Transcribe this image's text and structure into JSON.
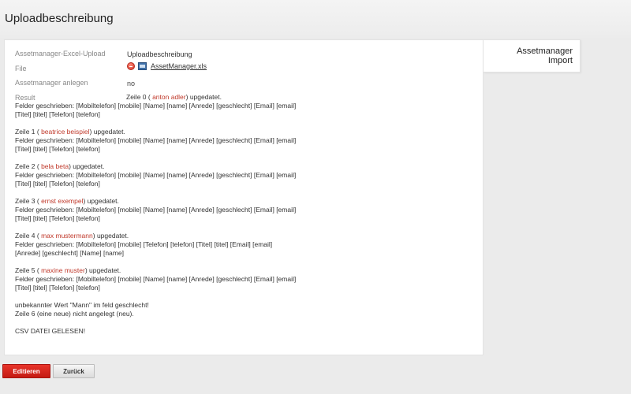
{
  "page": {
    "title": "Uploadbeschreibung"
  },
  "side_box": {
    "line1": "Assetmanager",
    "line2": "Import"
  },
  "fields": [
    {
      "label": "Assetmanager-Excel-Upload",
      "value": "Uploadbeschreibung"
    },
    {
      "label": "File",
      "value": "AssetManager.xls"
    },
    {
      "label": "Assetmanager anlegen",
      "value": "no"
    },
    {
      "label": "Result",
      "value": ""
    }
  ],
  "file_icons": [
    "delete-icon",
    "excel-file-icon"
  ],
  "result": {
    "entries": [
      {
        "pre": "Zeile 0 ( ",
        "name": "anton adler",
        "post": ") upgedatet.",
        "fields": "Felder geschrieben: [Mobiltelefon] [mobile] [Name] [name] [Anrede] [geschlecht] [Email] [email] [Titel] [titel] [Telefon] [telefon]"
      },
      {
        "pre": "Zeile 1 ( ",
        "name": "beatrice beispiel",
        "post": ") upgedatet.",
        "fields": "Felder geschrieben: [Mobiltelefon] [mobile] [Name] [name] [Anrede] [geschlecht] [Email] [email] [Titel] [titel] [Telefon] [telefon]"
      },
      {
        "pre": "Zeile 2 ( ",
        "name": "bela beta",
        "post": ") upgedatet.",
        "fields": "Felder geschrieben: [Mobiltelefon] [mobile] [Name] [name] [Anrede] [geschlecht] [Email] [email] [Titel] [titel] [Telefon] [telefon]"
      },
      {
        "pre": "Zeile 3 ( ",
        "name": "ernst exempel",
        "post": ") upgedatet.",
        "fields": "Felder geschrieben: [Mobiltelefon] [mobile] [Name] [name] [Anrede] [geschlecht] [Email] [email] [Titel] [titel] [Telefon] [telefon]"
      },
      {
        "pre": "Zeile 4 ( ",
        "name": "max mustermann",
        "post": ") upgedatet.",
        "fields": "Felder geschrieben: [Mobiltelefon] [mobile] [Telefon] [telefon] [Titel] [titel] [Email] [email] [Anrede] [geschlecht] [Name] [name]"
      },
      {
        "pre": "Zeile 5 ( ",
        "name": "maxine muster",
        "post": ") upgedatet.",
        "fields": "Felder geschrieben: [Mobiltelefon] [mobile] [Name] [name] [Anrede] [geschlecht] [Email] [email] [Titel] [titel] [Telefon] [telefon]"
      }
    ],
    "warning_1": "unbekannter Wert \"Mann\" im feld geschlecht!",
    "warning_2": "Zeile 6 (eine neue) nicht angelegt (neu).",
    "footer": "CSV DATEI GELESEN!"
  },
  "buttons": {
    "edit": "Editieren",
    "back": "Zurück"
  },
  "colors": {
    "accent_red": "#c41a12",
    "name_highlight": "#c0392b"
  }
}
